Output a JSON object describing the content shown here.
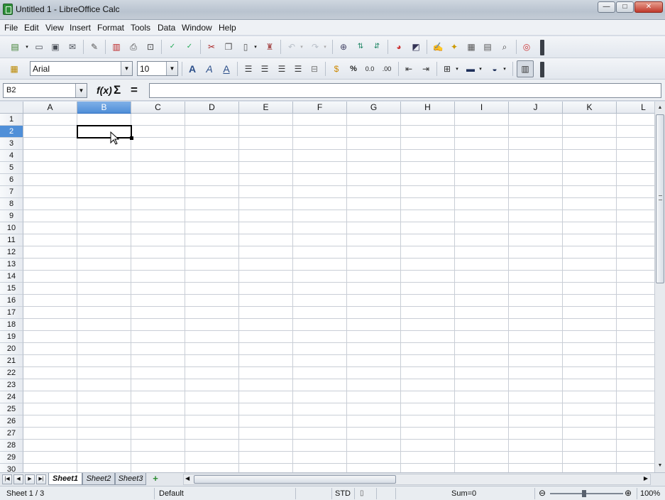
{
  "window": {
    "title": "Untitled 1 - LibreOffice Calc",
    "controls": {
      "minimize": "—",
      "maximize": "□",
      "close": "✕"
    }
  },
  "menubar": [
    "File",
    "Edit",
    "View",
    "Insert",
    "Format",
    "Tools",
    "Data",
    "Window",
    "Help"
  ],
  "formatting": {
    "font_name": "Arial",
    "font_size": "10"
  },
  "formula_bar": {
    "name_box": "B2",
    "function_wizard": "f(x)",
    "sum_symbol": "Σ",
    "equals_symbol": "=",
    "formula": ""
  },
  "grid": {
    "columns": [
      "A",
      "B",
      "C",
      "D",
      "E",
      "F",
      "G",
      "H",
      "I",
      "J",
      "K",
      "L"
    ],
    "rows": [
      "1",
      "2",
      "3",
      "4",
      "5",
      "6",
      "7",
      "8",
      "9",
      "10",
      "11",
      "12",
      "13",
      "14",
      "15",
      "16",
      "17",
      "18",
      "19",
      "20",
      "21",
      "22",
      "23",
      "24",
      "25",
      "26",
      "27",
      "28",
      "29",
      "30"
    ],
    "selected_column": "B",
    "selected_row": "2",
    "active_cell": "B2"
  },
  "sheets": {
    "tabs": [
      "Sheet1",
      "Sheet2",
      "Sheet3"
    ],
    "active": "Sheet1",
    "add_label": "+"
  },
  "statusbar": {
    "sheet": "Sheet 1 / 3",
    "page_style": "Default",
    "selection_mode": "STD",
    "sum": "Sum=0",
    "zoom": "100%"
  },
  "colors": {
    "selection_header": "#4f8fd8",
    "add_sheet_green": "#2d8c32"
  },
  "toolbar_icons": {
    "standard": [
      "new-document-icon",
      "open-icon",
      "save-icon",
      "email-icon",
      "edit-file-icon",
      "export-pdf-icon",
      "print-icon",
      "print-preview-icon",
      "spellcheck-icon",
      "autospellcheck-icon",
      "cut-icon",
      "copy-icon",
      "paste-icon",
      "clone-formatting-icon",
      "undo-icon",
      "redo-icon",
      "hyperlink-icon",
      "sort-ascending-icon",
      "sort-descending-icon",
      "chart-icon",
      "pivot-table-icon",
      "show-draw-functions-icon",
      "navigator-icon",
      "gallery-icon",
      "data-sources-icon",
      "zoom-icon",
      "help-icon"
    ],
    "formatting": [
      "styles-icon",
      "bold-icon",
      "italic-icon",
      "underline-icon",
      "align-left-icon",
      "align-center-icon",
      "align-right-icon",
      "justify-icon",
      "merge-cells-icon",
      "currency-icon",
      "percent-icon",
      "number-format-icon",
      "add-decimal-icon",
      "delete-decimal-icon",
      "decrease-indent-icon",
      "increase-indent-icon",
      "borders-icon",
      "background-color-icon",
      "font-color-icon",
      "toggle-grid-icon"
    ]
  }
}
